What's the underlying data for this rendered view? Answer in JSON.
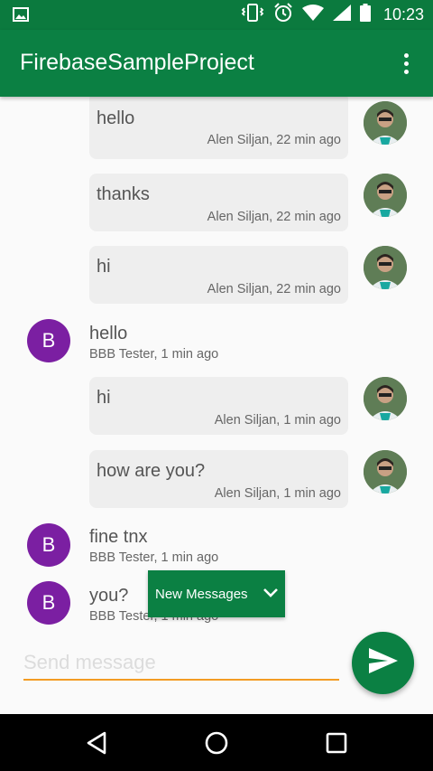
{
  "status_bar": {
    "time": "10:23",
    "icons": [
      "image-icon",
      "vibrate-icon",
      "alarm-icon",
      "wifi-icon",
      "cell-signal-icon",
      "battery-icon"
    ]
  },
  "app_bar": {
    "title": "FirebaseSampleProject",
    "overflow_icon": "more-vert-icon"
  },
  "messages": [
    {
      "own": true,
      "text": "hello",
      "meta": "Alen Siljan, 22 min ago"
    },
    {
      "own": true,
      "text": "thanks",
      "meta": "Alen Siljan, 22 min ago"
    },
    {
      "own": true,
      "text": "hi",
      "meta": "Alen Siljan, 22 min ago"
    },
    {
      "own": false,
      "avatar_letter": "B",
      "text": "hello",
      "meta": "BBB Tester, 1 min ago"
    },
    {
      "own": true,
      "text": "hi",
      "meta": "Alen Siljan, 1 min ago"
    },
    {
      "own": true,
      "text": "how are you?",
      "meta": "Alen Siljan, 1 min ago"
    },
    {
      "own": false,
      "avatar_letter": "B",
      "text": "fine tnx",
      "meta": "BBB Tester, 1 min ago"
    },
    {
      "own": false,
      "avatar_letter": "B",
      "text": "you?",
      "meta": "BBB Tester, 1 min ago"
    }
  ],
  "new_messages": {
    "label": "New Messages",
    "icon": "chevron-down-icon"
  },
  "composer": {
    "placeholder": "Send message",
    "value": "",
    "send_icon": "send-icon"
  },
  "nav_bar": {
    "buttons": [
      "back-icon",
      "home-icon",
      "recents-icon"
    ]
  },
  "colors": {
    "primary": "#0b8043",
    "primary_dark": "#0b7a3e",
    "accent": "#f39c24",
    "avatar_purple": "#7b1fa2",
    "bubble": "#eeeeee"
  }
}
